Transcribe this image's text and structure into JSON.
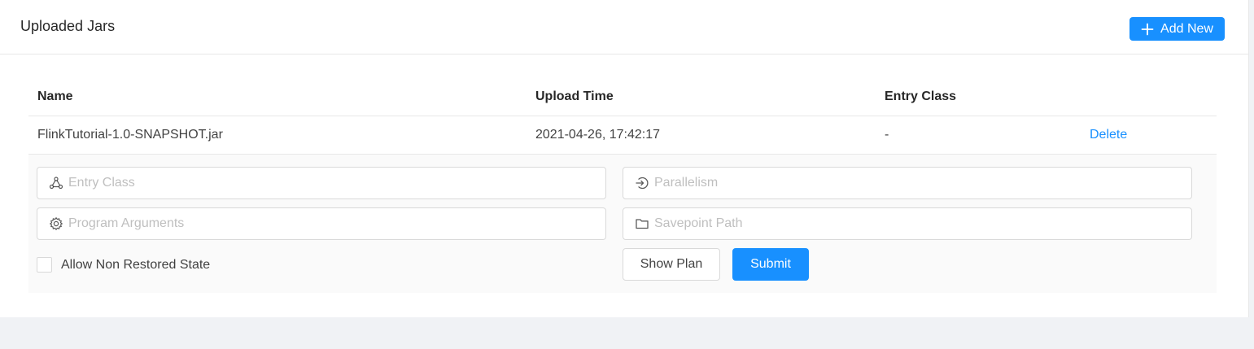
{
  "card": {
    "title": "Uploaded Jars",
    "add_button_label": "Add New",
    "add_icon": "plus-icon"
  },
  "table": {
    "columns": [
      "Name",
      "Upload Time",
      "Entry Class",
      ""
    ],
    "rows": [
      {
        "name": "FlinkTutorial-1.0-SNAPSHOT.jar",
        "upload_time": "2021-04-26, 17:42:17",
        "entry_class": "-",
        "action": "Delete"
      }
    ]
  },
  "form": {
    "entry_class": {
      "placeholder": "Entry Class",
      "value": "",
      "icon": "cluster-icon"
    },
    "parallelism": {
      "placeholder": "Parallelism",
      "value": "",
      "icon": "login-icon"
    },
    "program_arguments": {
      "placeholder": "Program Arguments",
      "value": "",
      "icon": "gear-icon"
    },
    "savepoint_path": {
      "placeholder": "Savepoint Path",
      "value": "",
      "icon": "folder-icon"
    },
    "allow_non_restored_label": "Allow Non Restored State",
    "allow_non_restored_checked": false,
    "show_plan_label": "Show Plan",
    "submit_label": "Submit"
  },
  "colors": {
    "primary": "#1890ff",
    "border": "#d9d9d9",
    "background": "#f0f2f5",
    "expanded_row_bg": "#fafafa"
  }
}
